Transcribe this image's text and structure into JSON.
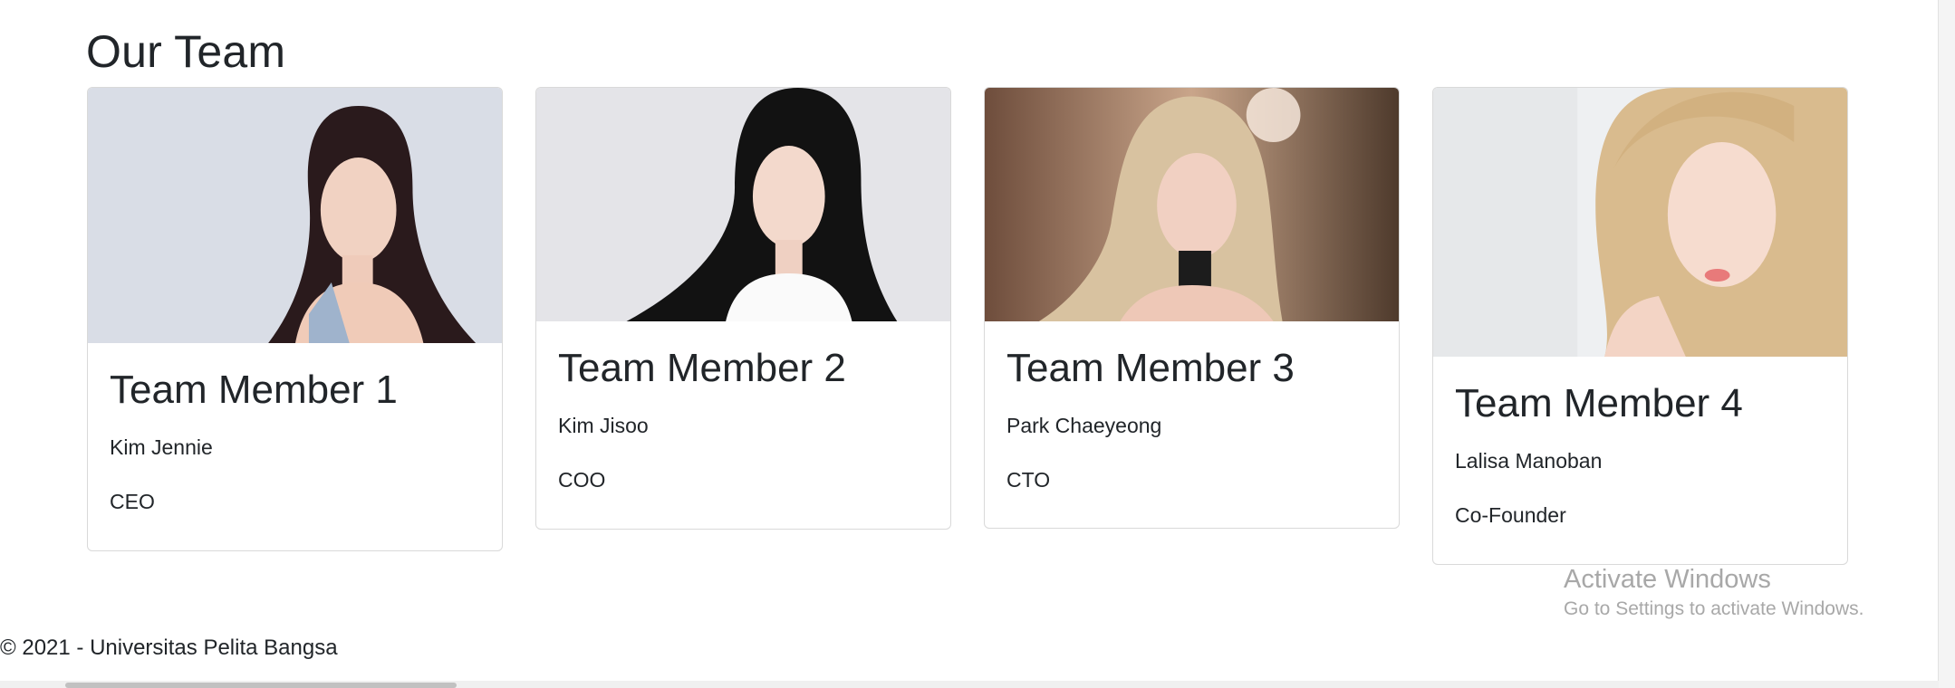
{
  "section_title": "Our Team",
  "members": [
    {
      "title": "Team Member 1",
      "name": "Kim Jennie",
      "role": "CEO",
      "photo_icon": "portrait-photo",
      "hair_color": "#2a1a1c",
      "bg_color": "#d9dde6"
    },
    {
      "title": "Team Member 2",
      "name": "Kim Jisoo",
      "role": "COO",
      "photo_icon": "portrait-photo",
      "hair_color": "#121212",
      "bg_color": "#e4e4e8"
    },
    {
      "title": "Team Member 3",
      "name": "Park Chaeyeong",
      "role": "CTO",
      "photo_icon": "portrait-photo",
      "hair_color": "#d8c2a0",
      "bg_color": "#8a6a55"
    },
    {
      "title": "Team Member 4",
      "name": "Lalisa Manoban",
      "role": "Co-Founder",
      "photo_icon": "portrait-photo",
      "hair_color": "#d9bb8e",
      "bg_color": "#eef0f2"
    }
  ],
  "watermark": {
    "line1": "Activate Windows",
    "line2": "Go to Settings to activate Windows."
  },
  "footer": {
    "text": "© 2021 - Universitas Pelita Bangsa"
  }
}
